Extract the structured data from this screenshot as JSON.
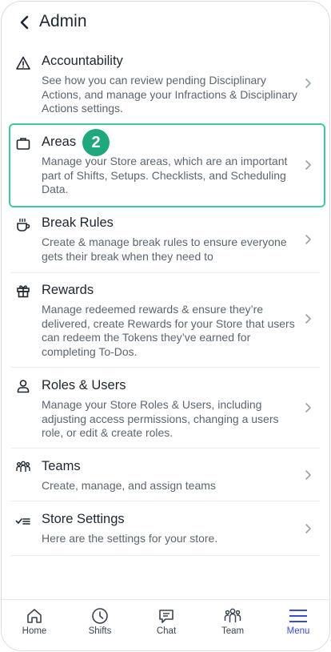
{
  "header": {
    "title": "Admin"
  },
  "items": [
    {
      "title": "Accountability",
      "desc": "See how you can review pending Disciplinary Actions, and manage your Infractions & Disciplinary Actions settings."
    },
    {
      "title": "Areas",
      "desc": "Manage your Store areas, which are an important part of Shifts, Setups. Checklists, and Scheduling Data."
    },
    {
      "title": "Break Rules",
      "desc": "Create & manage break rules to ensure everyone gets their break when they need to"
    },
    {
      "title": "Rewards",
      "desc": "Manage redeemed rewards & ensure they’re delivered, create Rewards for your Store that users can redeem the Tokens they’ve earned for completing To-Dos."
    },
    {
      "title": "Roles & Users",
      "desc": "Manage your Store Roles & Users, including adjusting access permissions, changing a users role, or edit & create roles."
    },
    {
      "title": "Teams",
      "desc": "Create, manage, and assign teams"
    },
    {
      "title": "Store Settings",
      "desc": "Here are the settings for your store."
    }
  ],
  "badge": "2",
  "tabs": [
    {
      "label": "Home"
    },
    {
      "label": "Shifts"
    },
    {
      "label": "Chat"
    },
    {
      "label": "Team"
    },
    {
      "label": "Menu"
    }
  ],
  "colors": {
    "accent": "#3b4bd8",
    "highlight": "#3fc9a3",
    "badge": "#1fa87e"
  }
}
